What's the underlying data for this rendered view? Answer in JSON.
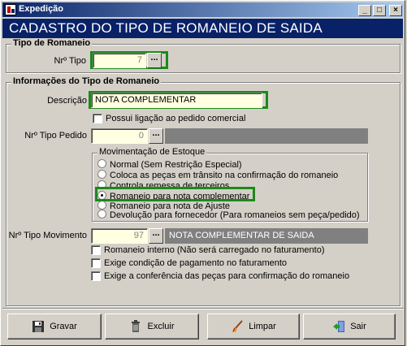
{
  "window": {
    "title": "Expedição",
    "controls": {
      "minimize": "_",
      "maximize": "□",
      "close": "×"
    }
  },
  "header": {
    "title": "CADASTRO DO TIPO DE ROMANEIO DE SAIDA"
  },
  "tipo_romaneio": {
    "group_title": "Tipo de Romaneio",
    "nr_tipo_label": "Nrº Tipo",
    "nr_tipo_value": "7",
    "lookup_label": "..."
  },
  "informacoes": {
    "group_title": "Informações do Tipo de Romaneio",
    "descricao_label": "Descrição",
    "descricao_value": "NOTA COMPLEMENTAR",
    "possui_ligacao_label": "Possui ligação ao pedido comercial",
    "nr_tipo_pedido_label": "Nrº Tipo Pedido",
    "nr_tipo_pedido_value": "0",
    "lookup_label": "...",
    "movimentacao": {
      "group_title": "Movimentação de Estoque",
      "options": [
        {
          "label": "Normal (Sem Restrição Especial)",
          "selected": false
        },
        {
          "label": "Coloca as peças em trânsito na confirmação do romaneio",
          "selected": false
        },
        {
          "label": "Controla remessa de terceiros",
          "selected": false
        },
        {
          "label": "Romaneio para nota complementar",
          "selected": true
        },
        {
          "label": "Romaneio para nota de Ajuste",
          "selected": false
        },
        {
          "label": "Devolução para fornecedor (Para romaneios sem peça/pedido)",
          "selected": false
        }
      ]
    },
    "nr_tipo_movimento_label": "Nrº Tipo Movimento",
    "nr_tipo_movimento_value": "97",
    "nr_tipo_movimento_desc": "NOTA COMPLEMENTAR DE SAIDA",
    "checkboxes": [
      {
        "label": "Romaneio interno (Não será carregado no faturamento)",
        "checked": false
      },
      {
        "label": "Exige condição de pagamento no faturamento",
        "checked": false
      },
      {
        "label": "Exige a conferência das peças para confirmação do romaneio",
        "checked": false
      }
    ]
  },
  "buttons": {
    "gravar": "Gravar",
    "excluir": "Excluir",
    "limpar": "Limpar",
    "sair": "Sair"
  },
  "colors": {
    "header_bg": "#082167",
    "highlight": "#1a8a1a",
    "field_yellow": "#ffffe1"
  }
}
